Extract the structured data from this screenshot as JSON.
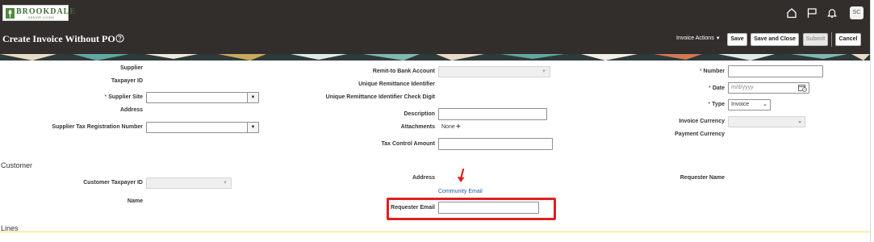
{
  "header": {
    "logo_name": "BROOKDALE",
    "logo_tagline": "SENIOR LIVING",
    "page_title": "Create Invoice Without PO",
    "avatar_initials": "SC",
    "invoice_actions_label": "Invoice Actions",
    "save_label": "Save",
    "save_close_label": "Save and Close",
    "submit_label": "Submit",
    "cancel_label": "Cancel",
    "icons": [
      "home-icon",
      "flag-icon",
      "bell-icon",
      "help-icon"
    ]
  },
  "form": {
    "col1": {
      "supplier_label": "Supplier",
      "taxpayer_id_label": "Taxpayer ID",
      "supplier_site_label": "Supplier Site",
      "address_label": "Address",
      "tax_reg_label": "Supplier Tax Registration Number"
    },
    "col2": {
      "remit_bank_label": "Remit-to Bank Account",
      "uri_label": "Unique Remittance Identifier",
      "uri_check_label": "Unique Remittance Identifier Check Digit",
      "description_label": "Description",
      "attachments_label": "Attachments",
      "attachments_value": "None",
      "tax_control_label": "Tax Control Amount"
    },
    "col3": {
      "number_label": "Number",
      "date_label": "Date",
      "date_placeholder": "m/d/yyyy",
      "type_label": "Type",
      "type_value": "Invoice",
      "invoice_currency_label": "Invoice Currency",
      "payment_currency_label": "Payment Currency"
    },
    "required_marker": "*"
  },
  "customer": {
    "section_title": "Customer",
    "taxpayer_label": "Customer Taxpayer ID",
    "name_label": "Name",
    "address_label": "Address",
    "community_email_link": "Community Email",
    "requester_email_label": "Requester Email",
    "requester_name_label": "Requester Name"
  },
  "lines": {
    "section_title": "Lines"
  },
  "colors": {
    "header_bg": "#322e2b",
    "highlight": "#e02020",
    "link": "#1f5c99"
  }
}
